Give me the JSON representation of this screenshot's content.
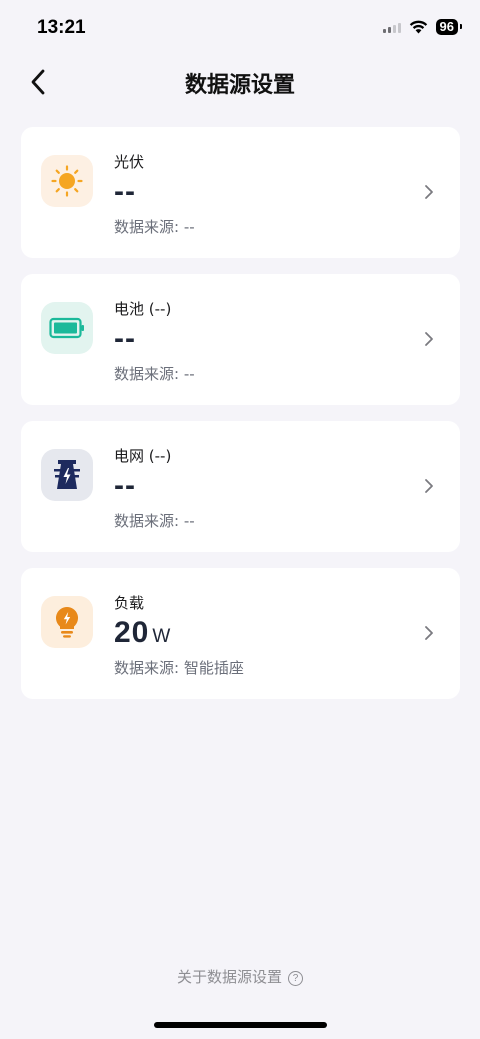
{
  "status_bar": {
    "time": "13:21",
    "battery": "96"
  },
  "nav": {
    "title": "数据源设置",
    "back_icon": "chevron-left-icon"
  },
  "cards": [
    {
      "title": "光伏",
      "value": "--",
      "unit": "",
      "source": "数据来源: --",
      "icon": "sun-icon",
      "icon_bg": "#fdf0e3",
      "icon_color": "#f5a623"
    },
    {
      "title": "电池 (--)",
      "value": "--",
      "unit": "",
      "source": "数据来源: --",
      "icon": "battery-icon",
      "icon_bg": "#e2f4ef",
      "icon_color": "#1bb99a"
    },
    {
      "title": "电网 (--)",
      "value": "--",
      "unit": "",
      "source": "数据来源: --",
      "icon": "power-tower-icon",
      "icon_bg": "#e6e8ee",
      "icon_color": "#1d2a5e"
    },
    {
      "title": "负载",
      "value": "20",
      "unit": "W",
      "source": "数据来源: 智能插座",
      "icon": "lightbulb-icon",
      "icon_bg": "#fdeedd",
      "icon_color": "#e8891a"
    }
  ],
  "footer": {
    "link_text": "关于数据源设置",
    "help_glyph": "?"
  }
}
